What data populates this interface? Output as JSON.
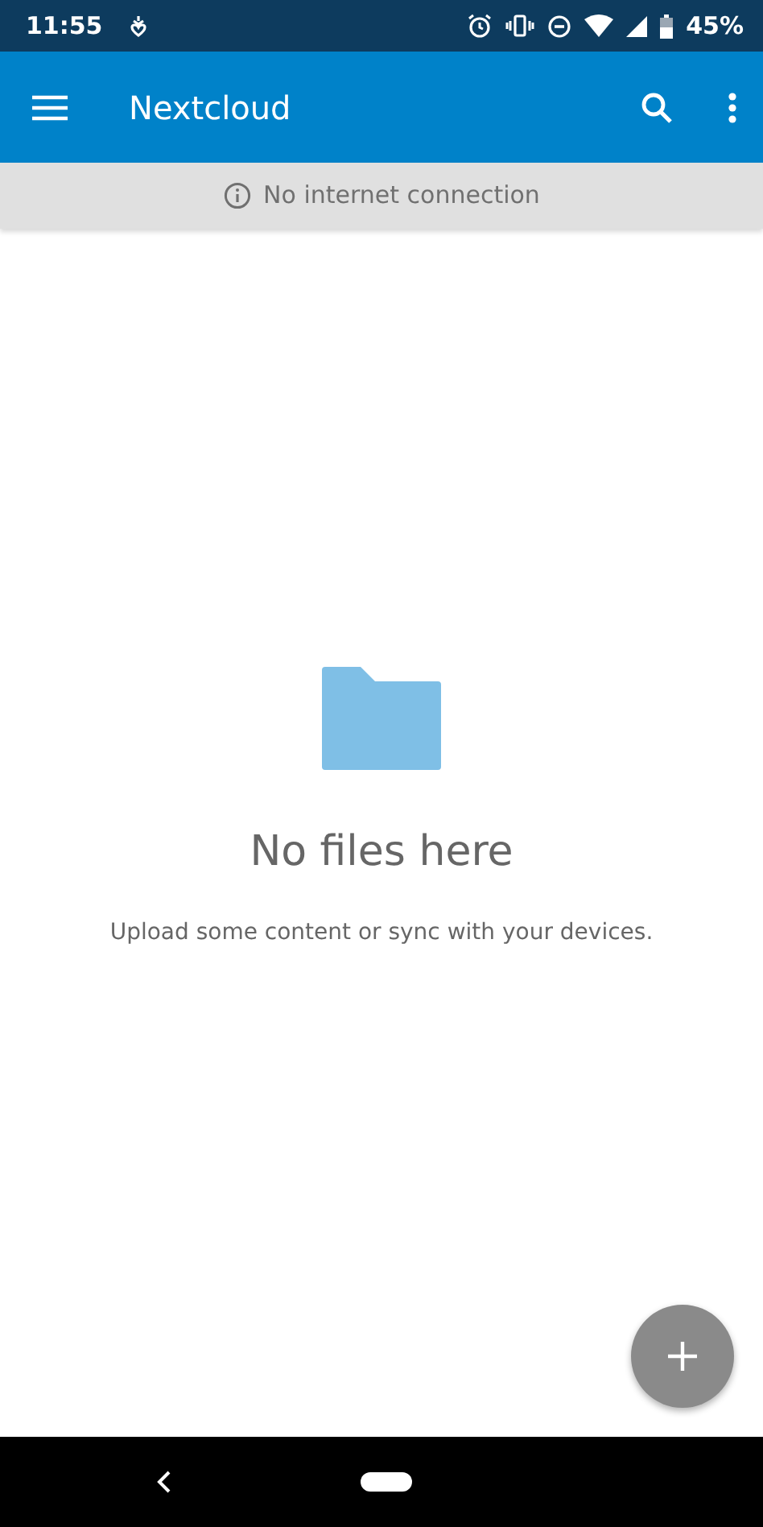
{
  "status_bar": {
    "time": "11:55",
    "battery": "45%"
  },
  "app_bar": {
    "title": "Nextcloud"
  },
  "banner": {
    "text": "No internet connection"
  },
  "empty_state": {
    "title": "No files here",
    "message": "Upload some content or sync with your devices."
  }
}
